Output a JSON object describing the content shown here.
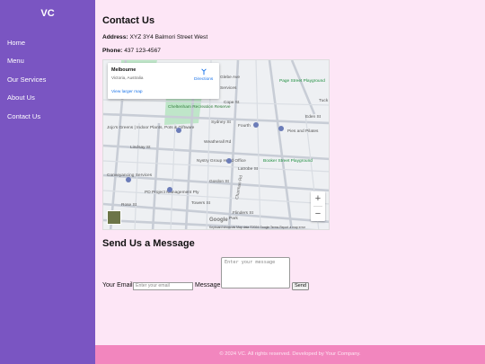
{
  "brand": "VC",
  "nav": {
    "items": [
      {
        "label": "Home"
      },
      {
        "label": "Menu"
      },
      {
        "label": "Our Services"
      },
      {
        "label": "About Us"
      },
      {
        "label": "Contact Us"
      }
    ]
  },
  "contact": {
    "title": "Contact Us",
    "address_label": "Address:",
    "address": "XYZ 3Y4 Balmori Street West",
    "phone_label": "Phone:",
    "phone": "437 123-4567"
  },
  "map": {
    "place": "Melbourne",
    "region": "Victoria, Australia",
    "directions": "Directions",
    "larger": "View larger map",
    "zoom_in": "+",
    "zoom_out": "−",
    "google": "Google",
    "footnote": "Keyboard shortcuts   Map data ©2024 Google   Terms   Report a map error",
    "labels": {
      "gleba": "Glebe Ave",
      "services": "Services",
      "park": "Cheltenham Recreation Reserve",
      "cope": "Cope St",
      "playground1": "Page Street Playground",
      "tuck": "Tuck",
      "jojos": "Jojo's Greens | Indoor Plants, Pots & Giftware",
      "fourth": "Fourth",
      "pies": "Pies and Pilates",
      "eden": "Eden St",
      "sydney": "Sydney St",
      "weatherall": "Weatherall Rd",
      "lindsay": "Lindsay St",
      "nystry": "Nystry Group Head Office",
      "playground2": "Booker Street Playground",
      "latrobe": "Latrobe St",
      "conveyancing": "Conveyancing Services",
      "gordon": "Gordon St",
      "pd": "PD Project Management Pty",
      "towers": "Towers St",
      "rose": "Rose St",
      "flinders": "Flinders St",
      "charman": "Charman Rd",
      "park_lbl": "Park"
    }
  },
  "message": {
    "title": "Send Us a Message",
    "email_label": "Your Email",
    "email_placeholder": "Enter your email",
    "message_label": "Message",
    "message_placeholder": "Enter your message",
    "send": "Send"
  },
  "footer": "© 2024 VC. All rights reserved. Developed by Your Company."
}
